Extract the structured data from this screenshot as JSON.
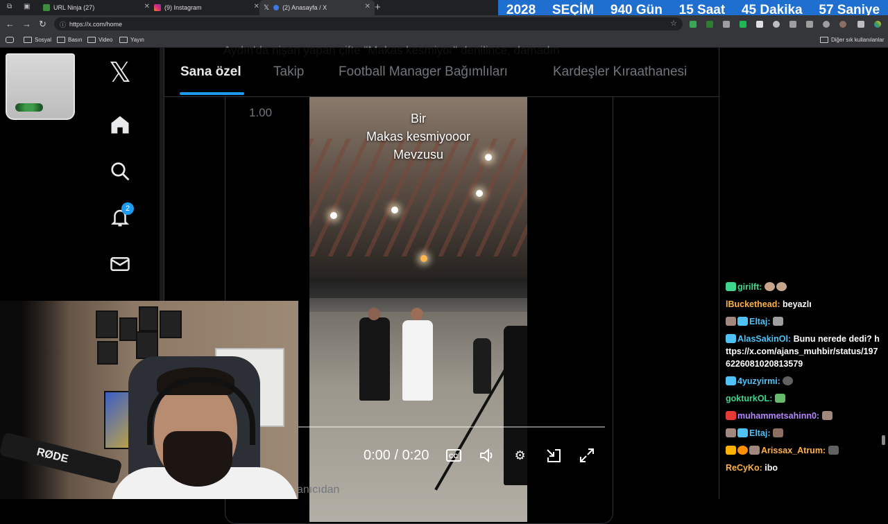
{
  "browser": {
    "tabs": [
      {
        "title": "URL Ninja (27)"
      },
      {
        "title": "(9) Instagram"
      },
      {
        "title": "(2) Anasayfa / X"
      }
    ],
    "new_tab_glyph": "+",
    "address": "https://x.com/home",
    "bookmarks": [
      "Sosyal",
      "Basın",
      "Video",
      "Yayın"
    ],
    "other_bookmarks": "Diğer sık kullanılanlar"
  },
  "countdown": {
    "year": "2028",
    "label": "SEÇİM",
    "days": "940 Gün",
    "hours": "15 Saat",
    "minutes": "45 Dakika",
    "seconds": "57 Saniye"
  },
  "x": {
    "notification_count": "2",
    "feed_top_text": "Aydın'da nişan yapan çifte \"Makas kesmiyor\" denilince, damadın",
    "feed_tabs": [
      "Sana özel",
      "Takip",
      "Football Manager Bağımlıları",
      "Kardeşler Kıraathanesi"
    ],
    "ratio_label": "1.00",
    "video": {
      "caption_lines": [
        "Bir",
        "Makas kesmiyooor",
        "Mevzusu"
      ],
      "time": "0:00 / 0:20"
    },
    "feed_bottom_text": "anıcıdan"
  },
  "webcam": {
    "mic_brand": "RØDE"
  },
  "chat": {
    "messages": [
      {
        "user": "girilft:",
        "text": "",
        "color": "#3dd68c"
      },
      {
        "user": "lBuckethead:",
        "text": "beyazlı",
        "color": "#ffb347"
      },
      {
        "user": "Eltaj:",
        "text": "",
        "color": "#4fc3f7"
      },
      {
        "user": "AlasSakinOl:",
        "text": "Bunu nerede dedi? https://x.com/ajans_muhbir/status/1976226081020813579",
        "color": "#4fc3f7"
      },
      {
        "user": "4yuzyirmi:",
        "text": "",
        "color": "#4fc3f7"
      },
      {
        "user": "gokturkOL:",
        "text": "",
        "color": "#3dd68c"
      },
      {
        "user": "muhammetsahinn0:",
        "text": "",
        "color": "#b388ff"
      },
      {
        "user": "Eltaj:",
        "text": "",
        "color": "#4fc3f7"
      },
      {
        "user": "Arissax_Atrum:",
        "text": "",
        "color": "#ffb347"
      },
      {
        "user": "ReCyKo:",
        "text": "ibo",
        "color": "#ffb347"
      }
    ]
  }
}
